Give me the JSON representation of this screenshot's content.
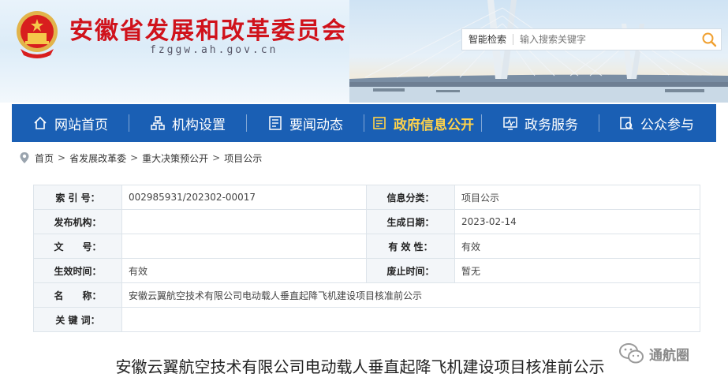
{
  "header": {
    "site_title": "安徽省发展和改革委员会",
    "site_domain": "fzggw.ah.gov.cn"
  },
  "search": {
    "label": "智能检索",
    "placeholder": "输入搜索关键字"
  },
  "nav": {
    "items": [
      {
        "label": "网站首页",
        "icon": "home-icon"
      },
      {
        "label": "机构设置",
        "icon": "org-chart-icon"
      },
      {
        "label": "要闻动态",
        "icon": "news-icon"
      },
      {
        "label": "政府信息公开",
        "icon": "info-disclosure-icon",
        "active": true
      },
      {
        "label": "政务服务",
        "icon": "service-monitor-icon"
      },
      {
        "label": "公众参与",
        "icon": "participation-icon"
      }
    ]
  },
  "breadcrumb": {
    "items": [
      "首页",
      "省发展改革委",
      "重大决策预公开",
      "项目公示"
    ],
    "separator": ">"
  },
  "info_table": {
    "index_no_label": "索 引 号：",
    "index_no": "002985931/202302-00017",
    "category_label": "信息分类：",
    "category": "项目公示",
    "publisher_label": "发布机构：",
    "publisher": "",
    "created_label": "生成日期：",
    "created": "2023-02-14",
    "doc_no_label": "文　　号：",
    "doc_no": "",
    "validity_label": "有 效 性：",
    "validity": "有效",
    "effective_label": "生效时间：",
    "effective": "有效",
    "expiry_label": "废止时间：",
    "expiry": "暂无",
    "name_label": "名　　称：",
    "name": "安徽云翼航空技术有限公司电动载人垂直起降飞机建设项目核准前公示",
    "keywords_label": "关 键 词：",
    "keywords": ""
  },
  "article": {
    "title": "安徽云翼航空技术有限公司电动载人垂直起降飞机建设项目核准前公示"
  },
  "watermark": {
    "text": "通航圈"
  },
  "colors": {
    "nav_bg": "#1a5fb4",
    "title_red": "#d0121b",
    "active_yellow": "#ffd24a"
  }
}
